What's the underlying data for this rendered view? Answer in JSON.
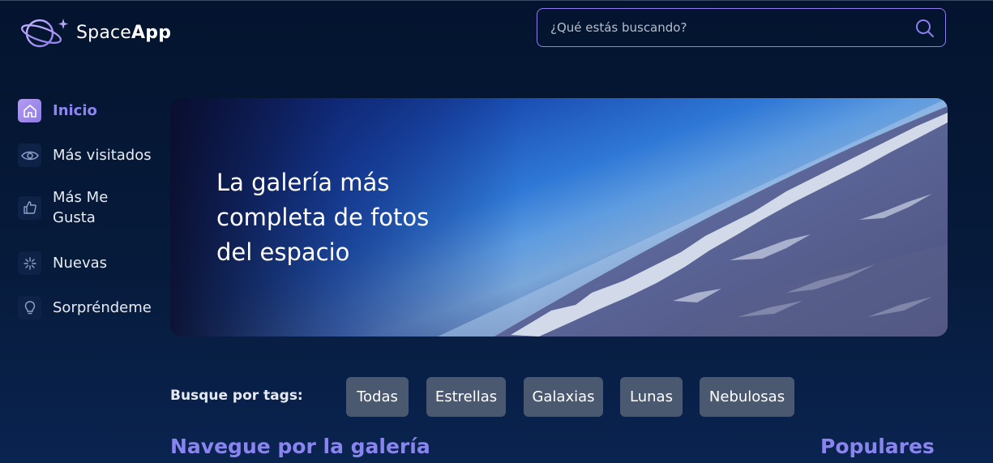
{
  "app": {
    "name_light": "Space",
    "name_bold": "App"
  },
  "search": {
    "placeholder": "¿Qué estás buscando?"
  },
  "sidebar": {
    "items": [
      {
        "label": "Inicio",
        "icon": "home-icon",
        "active": true
      },
      {
        "label": "Más visitados",
        "icon": "eye-icon",
        "active": false
      },
      {
        "label": "Más Me Gusta",
        "icon": "thumbs-up-icon",
        "active": false
      },
      {
        "label": "Nuevas",
        "icon": "sparkle-icon",
        "active": false
      },
      {
        "label": "Sorpréndeme",
        "icon": "lightbulb-icon",
        "active": false
      }
    ]
  },
  "banner": {
    "title": "La galería más completa de fotos del espacio"
  },
  "tags": {
    "label": "Busque por tags:",
    "items": [
      "Todas",
      "Estrellas",
      "Galaxias",
      "Lunas",
      "Nebulosas"
    ]
  },
  "sections": {
    "gallery_title": "Navegue por la galería",
    "popular_title": "Populares"
  },
  "colors": {
    "accent": "#8c85f2",
    "background": "#04142f",
    "tag_bg": "#4a5870",
    "search_border": "#8f7ef0"
  }
}
